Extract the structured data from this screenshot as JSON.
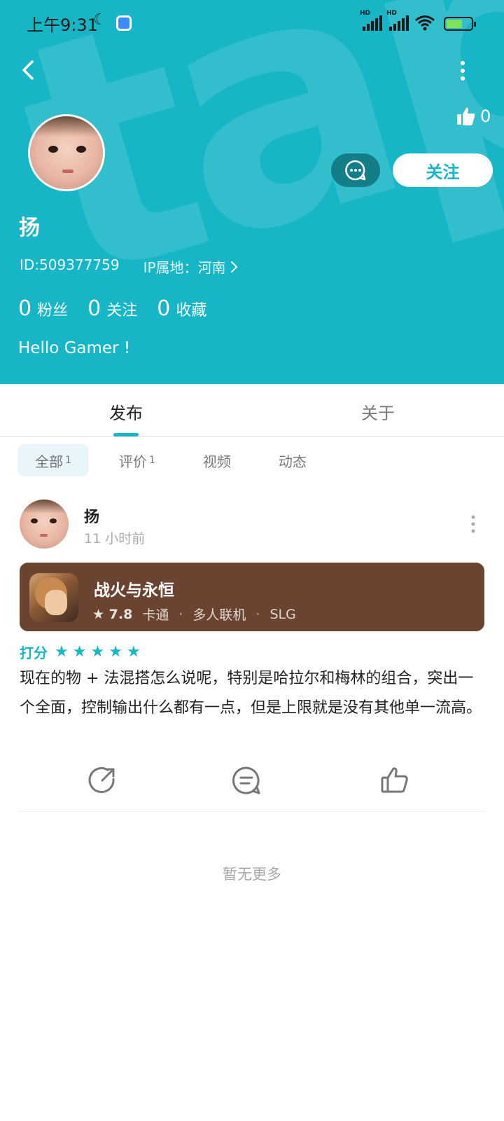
{
  "status_bar": {
    "time": "上午9:31",
    "moon_icon": "moon-icon",
    "signal_label": "HD"
  },
  "header": {
    "watermark": "tapta",
    "like_count": "0",
    "follow_label": "关注",
    "username": "扬",
    "id_text": "ID:509377759",
    "ip_text": "IP属地：河南",
    "stats": [
      {
        "num": "0",
        "label": "粉丝"
      },
      {
        "num": "0",
        "label": "关注"
      },
      {
        "num": "0",
        "label": "收藏"
      }
    ],
    "bio": "Hello Gamer !",
    "accent": "#16b6c6"
  },
  "tabs": [
    {
      "label": "发布"
    },
    {
      "label": "关于"
    }
  ],
  "filters": [
    {
      "label": "全部",
      "count": "1"
    },
    {
      "label": "评价",
      "count": "1"
    },
    {
      "label": "视频",
      "count": ""
    },
    {
      "label": "动态",
      "count": ""
    }
  ],
  "post": {
    "author": "扬",
    "time": "11 小时前",
    "game": {
      "title": "战火与永恒",
      "score": "7.8",
      "tags": [
        "卡通",
        "多人联机",
        "SLG"
      ]
    },
    "rating_label": "打分",
    "rating_stars": 5,
    "text": "现在的物 + 法混搭怎么说呢，特别是哈拉尔和梅林的组合，突出一个全面，控制输出什么都有一点，但是上限就是没有其他单一流高。"
  },
  "footer": {
    "no_more": "暂无更多"
  }
}
